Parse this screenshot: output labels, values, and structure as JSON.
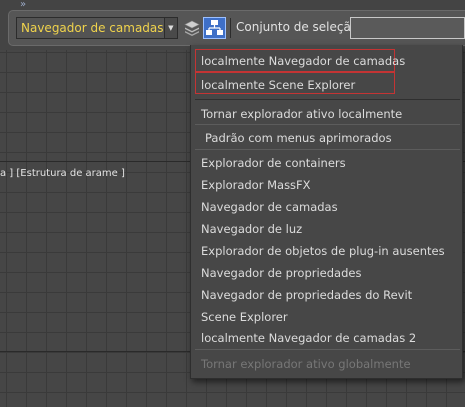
{
  "toolbar": {
    "expand_marker": "»",
    "layer_dropdown_value": "Navegador de camadas",
    "selection_set_label": "Conjunto de seleção:",
    "selection_set_value": ""
  },
  "viewport": {
    "label": "a ] [Estrutura de arame ]"
  },
  "menu": {
    "items": [
      "localmente Navegador de camadas",
      "localmente Scene Explorer",
      "Tornar explorador ativo localmente",
      "Padrão com menus aprimorados",
      "Explorador de containers",
      "Explorador MassFX",
      "Navegador de camadas",
      "Navegador de luz",
      "Explorador de objetos de plug-in ausentes",
      "Navegador de propriedades",
      "Navegador de propriedades do Revit",
      "Scene Explorer",
      "localmente Navegador de camadas 2",
      "Tornar explorador ativo globalmente"
    ]
  },
  "colors": {
    "dropdown_text": "#f0d34c",
    "highlight_border": "#c43434",
    "explorer_icon_bg": "#3e6fc7"
  }
}
